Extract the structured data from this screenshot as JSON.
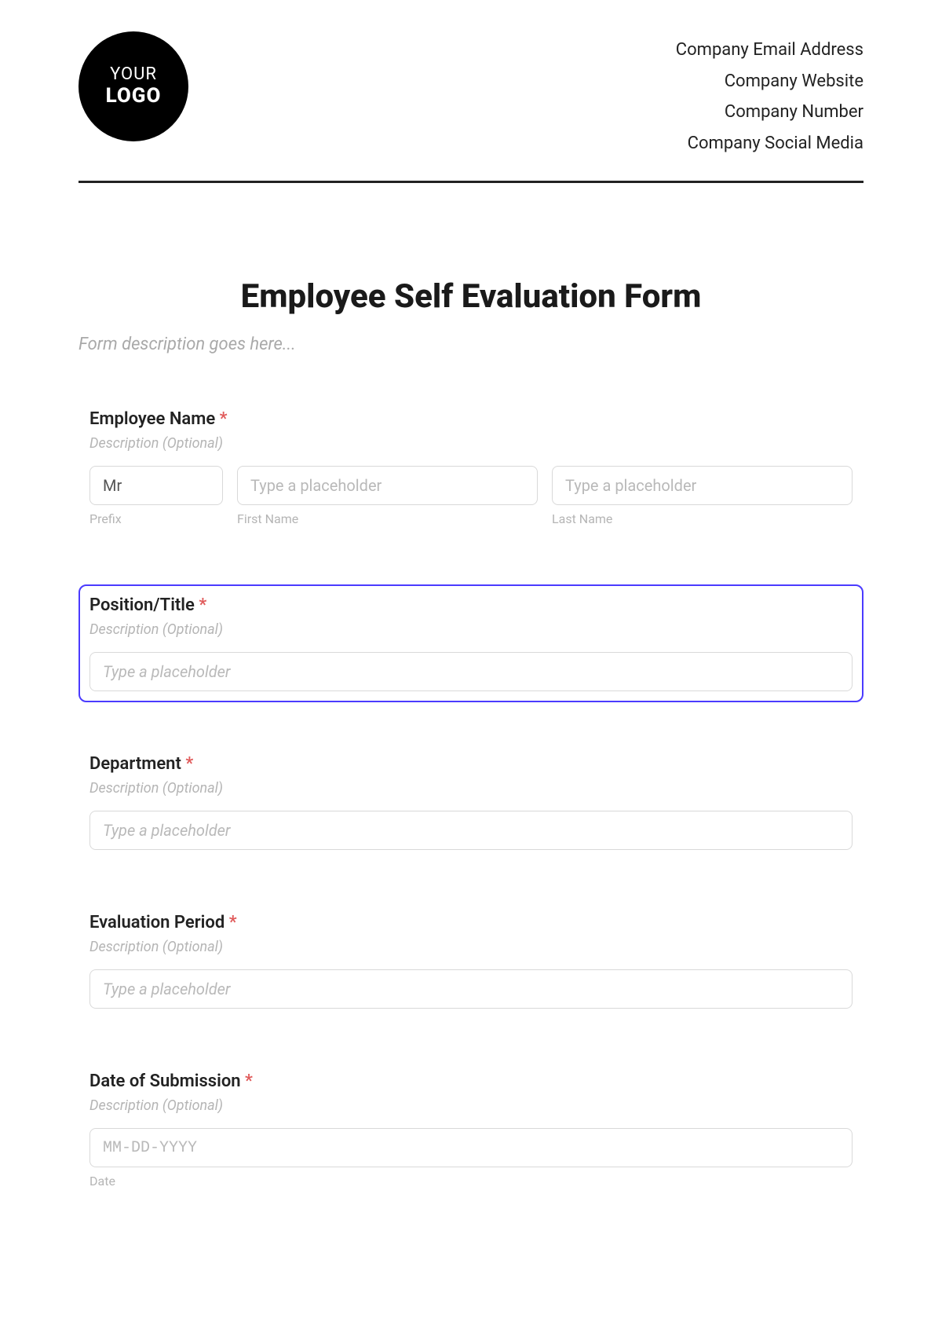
{
  "header": {
    "logo_line1": "YOUR",
    "logo_line2": "LOGO",
    "company_lines": [
      "Company Email Address",
      "Company Website",
      "Company Number",
      "Company Social Media"
    ]
  },
  "form": {
    "title": "Employee Self Evaluation Form",
    "description_placeholder": "Form description goes here...",
    "required_mark": "*"
  },
  "fields": {
    "employee_name": {
      "label": "Employee Name",
      "description": "Description (Optional)",
      "prefix": {
        "value": "Mr",
        "sublabel": "Prefix"
      },
      "first_name": {
        "placeholder": "Type a placeholder",
        "sublabel": "First Name"
      },
      "last_name": {
        "placeholder": "Type a placeholder",
        "sublabel": "Last Name"
      }
    },
    "position": {
      "label": "Position/Title",
      "description": "Description (Optional)",
      "placeholder": "Type a placeholder"
    },
    "department": {
      "label": "Department",
      "description": "Description (Optional)",
      "placeholder": "Type a placeholder"
    },
    "evaluation_period": {
      "label": "Evaluation Period",
      "description": "Description (Optional)",
      "placeholder": "Type a placeholder"
    },
    "date_submission": {
      "label": "Date of Submission",
      "description": "Description (Optional)",
      "placeholder": "MM-DD-YYYY",
      "sublabel": "Date"
    }
  }
}
